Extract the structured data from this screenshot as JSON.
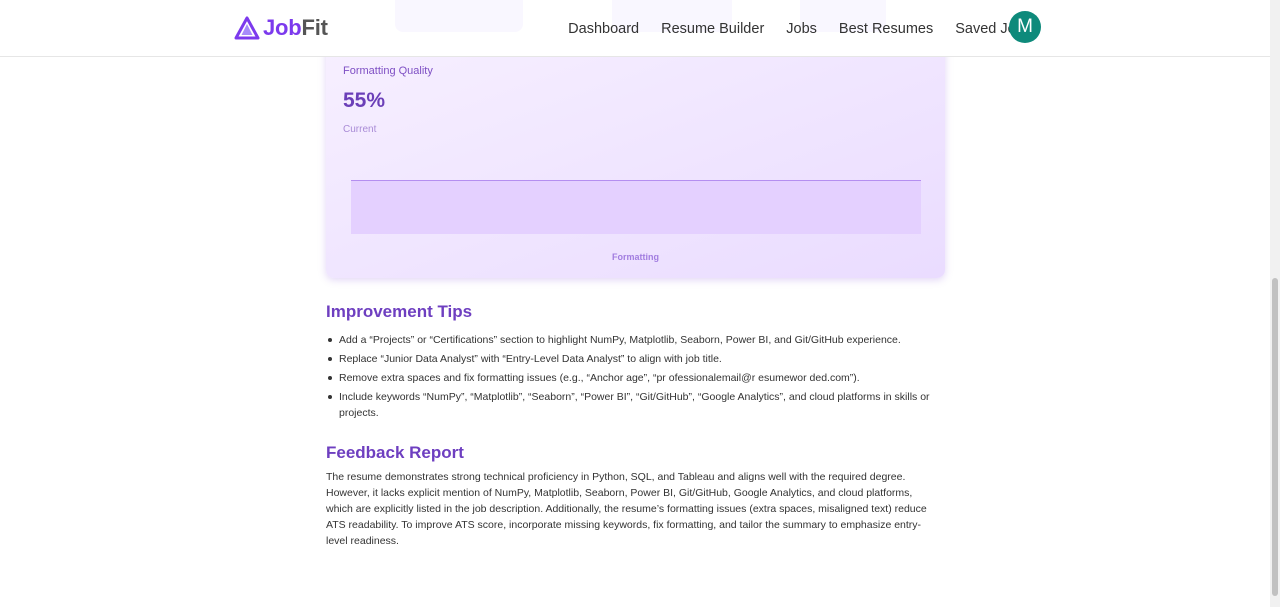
{
  "brand": {
    "name_part1": "Job",
    "name_part2": "Fit",
    "logo_icon": "triangle-logo-icon"
  },
  "nav": {
    "links": [
      {
        "label": "Dashboard"
      },
      {
        "label": "Resume Builder"
      },
      {
        "label": "Jobs"
      },
      {
        "label": "Best Resumes"
      },
      {
        "label": "Saved Jobs"
      }
    ],
    "avatar_initial": "M"
  },
  "metric_card": {
    "label": "Formatting Quality",
    "value": "55%",
    "sub_label": "Current",
    "chart_data": {
      "type": "area",
      "categories": [
        "Formatting"
      ],
      "values": [
        55
      ],
      "xlabel": "Formatting",
      "grid": false
    }
  },
  "improvement": {
    "title": "Improvement Tips",
    "tips": [
      "Add a “Projects” or “Certifications” section to highlight NumPy, Matplotlib, Seaborn, Power BI, and Git/GitHub experience.",
      "Replace “Junior Data Analyst” with “Entry-Level Data Analyst” to align with job title.",
      "Remove extra spaces and fix formatting issues (e.g., “Anchor age”, “pr ofessionalemail@r esumewor ded.com”).",
      "Include keywords “NumPy”, “Matplotlib”, “Seaborn”, “Power BI”, “Git/GitHub”, “Google Analytics”, and cloud platforms in skills or projects."
    ]
  },
  "feedback": {
    "title": "Feedback Report",
    "text": "The resume demonstrates strong technical proficiency in Python, SQL, and Tableau and aligns well with the required degree. However, it lacks explicit mention of NumPy, Matplotlib, Seaborn, Power BI, Git/GitHub, Google Analytics, and cloud platforms, which are explicitly listed in the job description. Additionally, the resume’s formatting issues (extra spaces, misaligned text) reduce ATS readability. To improve ATS score, incorporate missing keywords, fix formatting, and tailor the summary to emphasize entry-level readiness."
  },
  "colors": {
    "brand": "#7c3aed",
    "title": "#6e3fc0",
    "avatar": "#0e8a7b",
    "chart_line": "#b48ef0",
    "chart_fill": "#e4d0ff"
  }
}
